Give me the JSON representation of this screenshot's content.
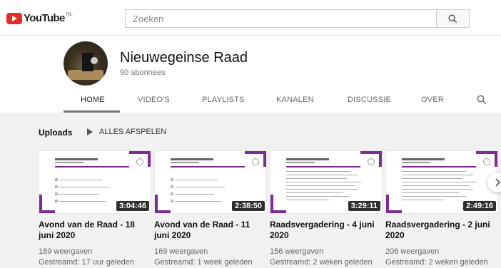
{
  "logo": {
    "text": "YouTube",
    "region": "NL"
  },
  "search": {
    "placeholder": "Zoeken"
  },
  "channel": {
    "name": "Nieuwegeinse Raad",
    "subscribers": "90 abonnees"
  },
  "tabs": [
    {
      "label": "HOME",
      "active": true
    },
    {
      "label": "VIDEO'S"
    },
    {
      "label": "PLAYLISTS"
    },
    {
      "label": "KANALEN"
    },
    {
      "label": "DISCUSSIE"
    },
    {
      "label": "OVER"
    }
  ],
  "uploads": {
    "title": "Uploads",
    "play_all": "ALLES AFSPELEN"
  },
  "videos": [
    {
      "title": "Avond van de Raad - 18 juni 2020",
      "duration": "3:04:46",
      "views": "189 weergaven",
      "streamed": "Gestreamd: 17 uur geleden"
    },
    {
      "title": "Avond van de Raad - 11 juni 2020",
      "duration": "2:38:50",
      "views": "169 weergaven",
      "streamed": "Gestreamd: 1 week geleden"
    },
    {
      "title": "Raadsvergadering - 4 juni 2020",
      "duration": "3:29:11",
      "views": "156 weergaven",
      "streamed": "Gestreamd: 2 weken geleden"
    },
    {
      "title": "Raadsvergadering - 2 juni 2020",
      "duration": "2:49:16",
      "views": "206 weergaven",
      "streamed": "Gestreamd: 2 weken geleden"
    }
  ],
  "colors": {
    "brand_red": "#e52d27",
    "thumbnail_accent": "#7b2d91"
  }
}
